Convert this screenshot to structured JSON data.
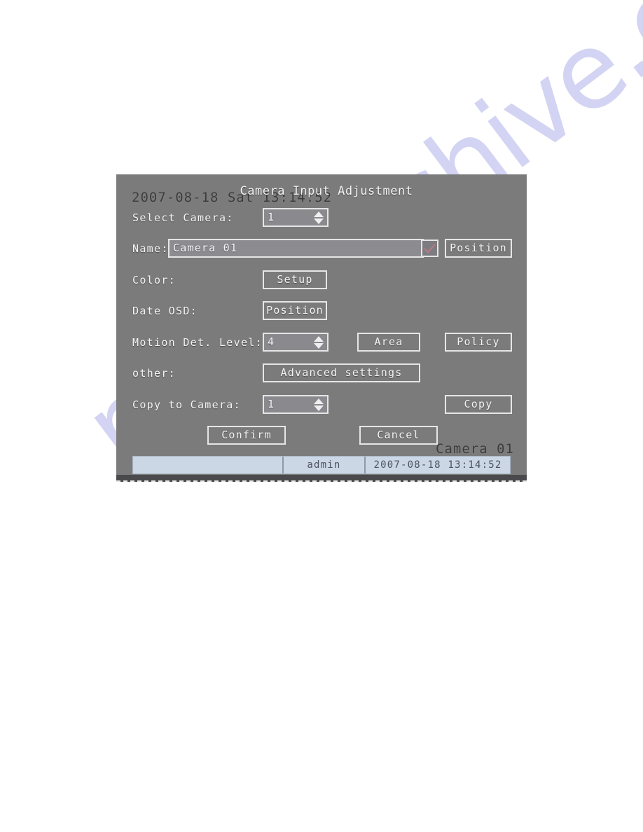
{
  "osd": {
    "datetime": "2007-08-18 Sat 13:14:52",
    "camera_name": "Camera 01"
  },
  "dialog": {
    "title": "Camera Input Adjustment",
    "rows": {
      "select_camera": {
        "label": "Select Camera:",
        "value": "1"
      },
      "name": {
        "label": "Name:",
        "value": "Camera 01",
        "checkbox_checked": true,
        "position_button": "Position"
      },
      "color": {
        "label": "Color:",
        "setup_button": "Setup"
      },
      "date_osd": {
        "label": "Date OSD:",
        "position_button": "Position"
      },
      "motion_det": {
        "label": "Motion Det. Level:",
        "value": "4",
        "area_button": "Area",
        "policy_button": "Policy"
      },
      "other": {
        "label": "other:",
        "advanced_button": "Advanced settings"
      },
      "copy_to_camera": {
        "label": "Copy to Camera:",
        "value": "1",
        "copy_button": "Copy"
      }
    },
    "actions": {
      "confirm": "Confirm",
      "cancel": "Cancel"
    }
  },
  "status_bar": {
    "blank": "",
    "user": "admin",
    "timestamp": "2007-08-18 13:14:52"
  },
  "watermark": {
    "text": "manualshive.com"
  },
  "colors": {
    "panel_bg": "#7b7b7b",
    "control_border": "#e6e6e6",
    "text": "#f4f4f4",
    "osd_text": "#3a3a3a",
    "status_bar_bg": "#ccd7e6",
    "checkbox_check": "#b07a84",
    "watermark": "#b9b9ec"
  }
}
